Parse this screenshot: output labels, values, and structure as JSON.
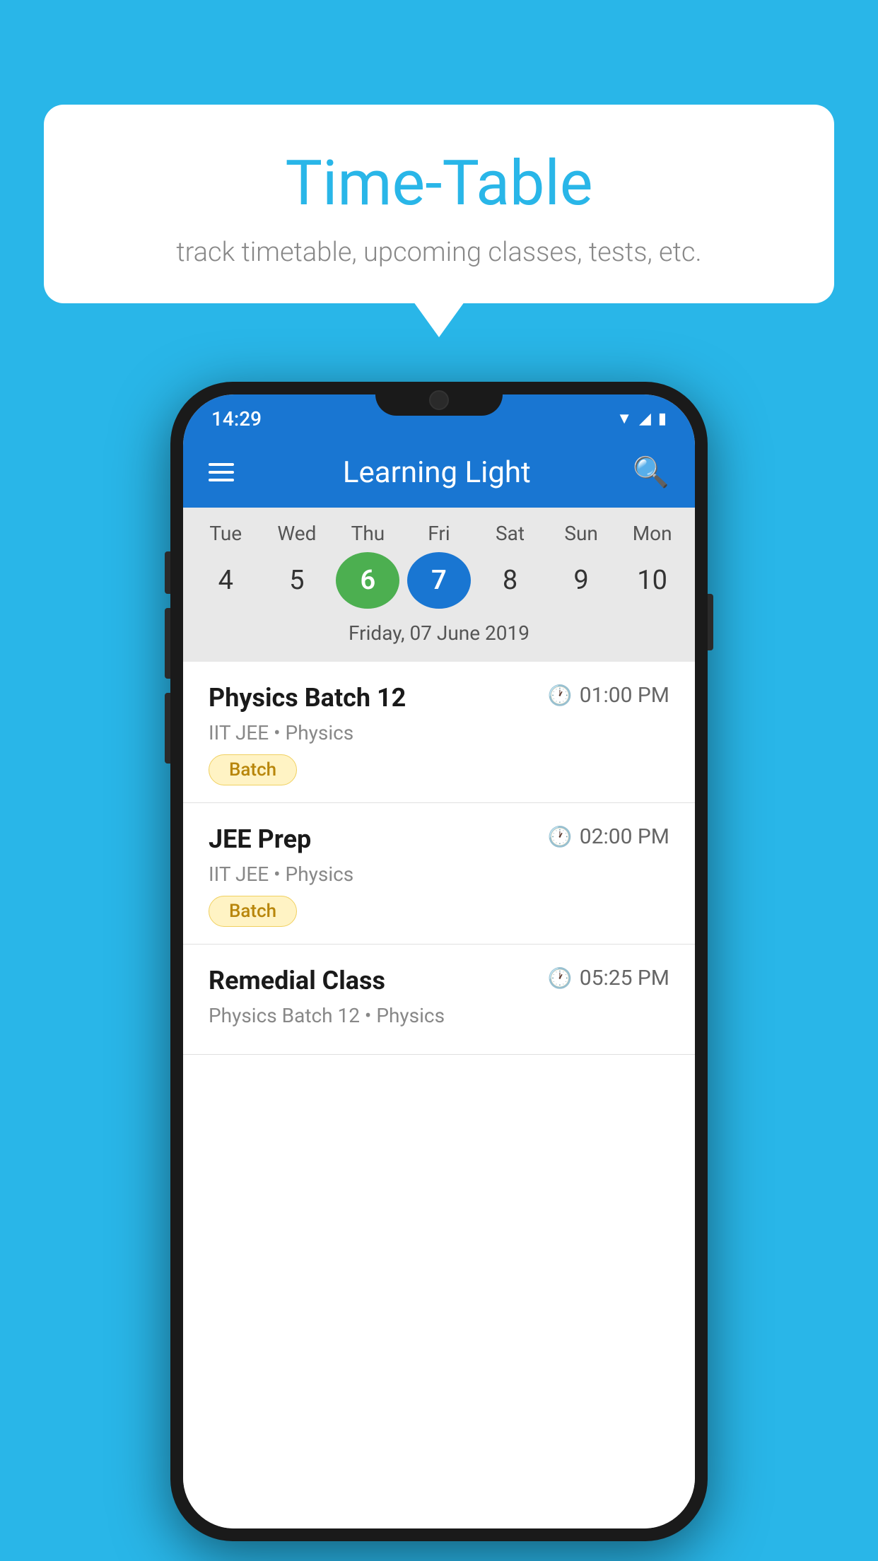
{
  "background_color": "#29B6E8",
  "speech_bubble": {
    "title": "Time-Table",
    "subtitle": "track timetable, upcoming classes, tests, etc."
  },
  "phone": {
    "status_bar": {
      "time": "14:29",
      "icons": [
        "wifi",
        "signal",
        "battery"
      ]
    },
    "app_bar": {
      "menu_icon": "hamburger-menu",
      "title": "Learning Light",
      "search_icon": "search"
    },
    "calendar": {
      "days": [
        {
          "label": "Tue",
          "number": "4"
        },
        {
          "label": "Wed",
          "number": "5"
        },
        {
          "label": "Thu",
          "number": "6",
          "state": "today"
        },
        {
          "label": "Fri",
          "number": "7",
          "state": "selected"
        },
        {
          "label": "Sat",
          "number": "8"
        },
        {
          "label": "Sun",
          "number": "9"
        },
        {
          "label": "Mon",
          "number": "10"
        }
      ],
      "selected_date": "Friday, 07 June 2019"
    },
    "schedule": [
      {
        "title": "Physics Batch 12",
        "time": "01:00 PM",
        "subtitle": "IIT JEE • Physics",
        "badge": "Batch"
      },
      {
        "title": "JEE Prep",
        "time": "02:00 PM",
        "subtitle": "IIT JEE • Physics",
        "badge": "Batch"
      },
      {
        "title": "Remedial Class",
        "time": "05:25 PM",
        "subtitle": "Physics Batch 12 • Physics",
        "badge": ""
      }
    ]
  }
}
